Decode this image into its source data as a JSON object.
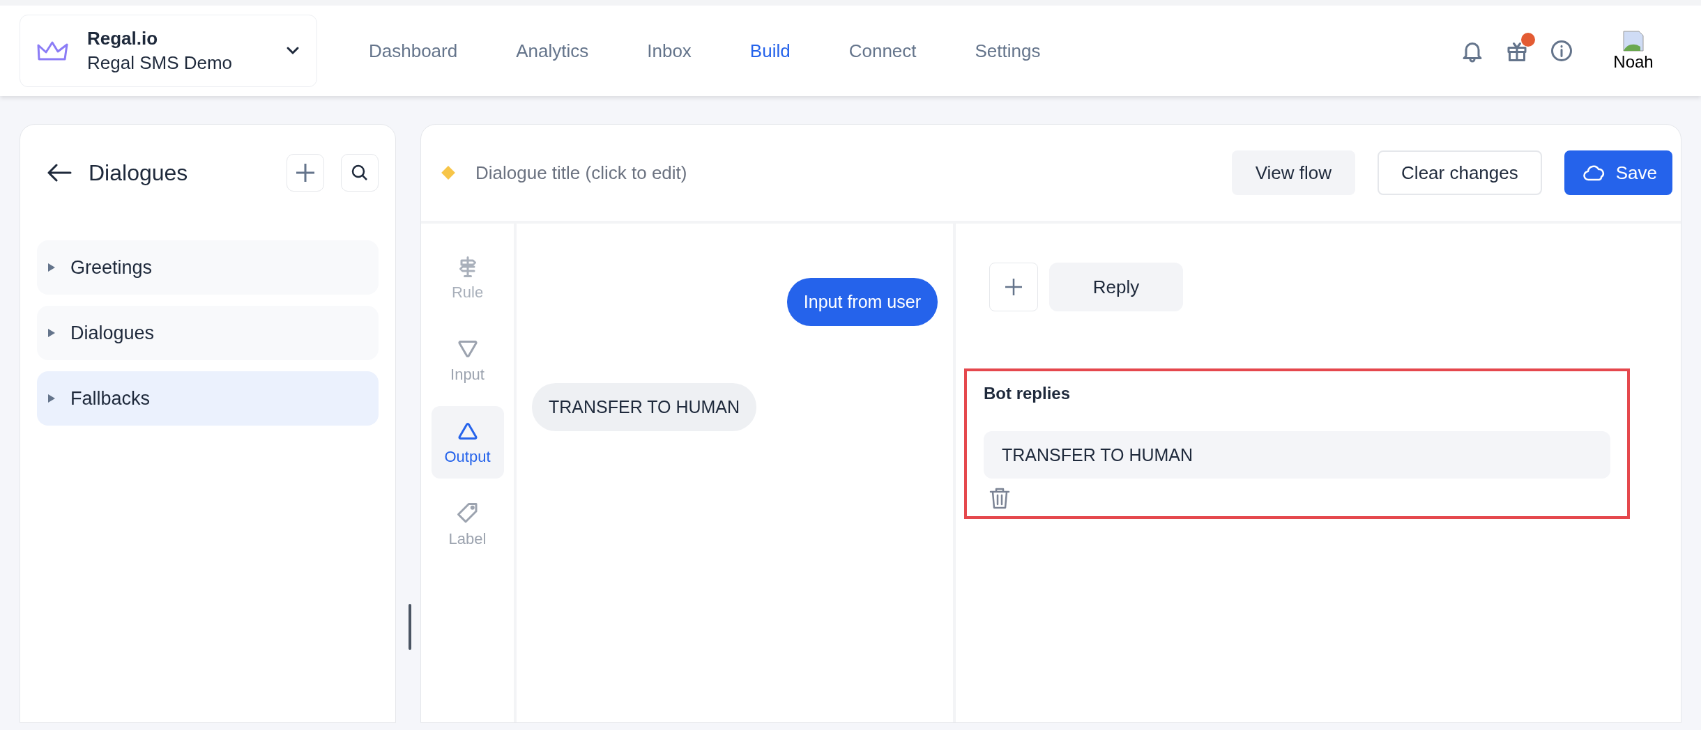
{
  "header": {
    "workspace": {
      "name": "Regal.io",
      "subtitle": "Regal SMS Demo"
    },
    "nav": [
      {
        "label": "Dashboard",
        "selected": false
      },
      {
        "label": "Analytics",
        "selected": false
      },
      {
        "label": "Inbox",
        "selected": false
      },
      {
        "label": "Build",
        "selected": true
      },
      {
        "label": "Connect",
        "selected": false
      },
      {
        "label": "Settings",
        "selected": false
      }
    ],
    "gift_badge": true,
    "user": {
      "avatar_alt": "Noah"
    }
  },
  "sidebar": {
    "title": "Dialogues",
    "groups": [
      {
        "label": "Greetings",
        "selected": false,
        "expanded": false
      },
      {
        "label": "Dialogues",
        "selected": false,
        "expanded": false
      },
      {
        "label": "Fallbacks",
        "selected": true,
        "expanded": false
      }
    ]
  },
  "editor": {
    "title_placeholder": "Dialogue title (click to edit)",
    "buttons": [
      {
        "label": "View flow",
        "kind": "secondary"
      },
      {
        "label": "Clear changes",
        "kind": "outline"
      },
      {
        "label": "Save",
        "kind": "primary"
      }
    ],
    "tools": [
      {
        "label": "Rule",
        "kind": "rule",
        "disabled": true,
        "selected": false
      },
      {
        "label": "Input",
        "kind": "input",
        "disabled": false,
        "selected": false
      },
      {
        "label": "Output",
        "kind": "output",
        "disabled": false,
        "selected": true
      },
      {
        "label": "Label",
        "kind": "label",
        "disabled": false,
        "selected": false
      }
    ],
    "conversation": [
      {
        "kind": "user",
        "text": "Input from user"
      },
      {
        "kind": "bot",
        "text": "TRANSFER TO HUMAN"
      }
    ],
    "add_reply": {
      "label": "Reply"
    },
    "bot_replies": {
      "title": "Bot replies",
      "highlighted": true,
      "items": [
        {
          "value": "TRANSFER TO HUMAN"
        }
      ]
    }
  }
}
